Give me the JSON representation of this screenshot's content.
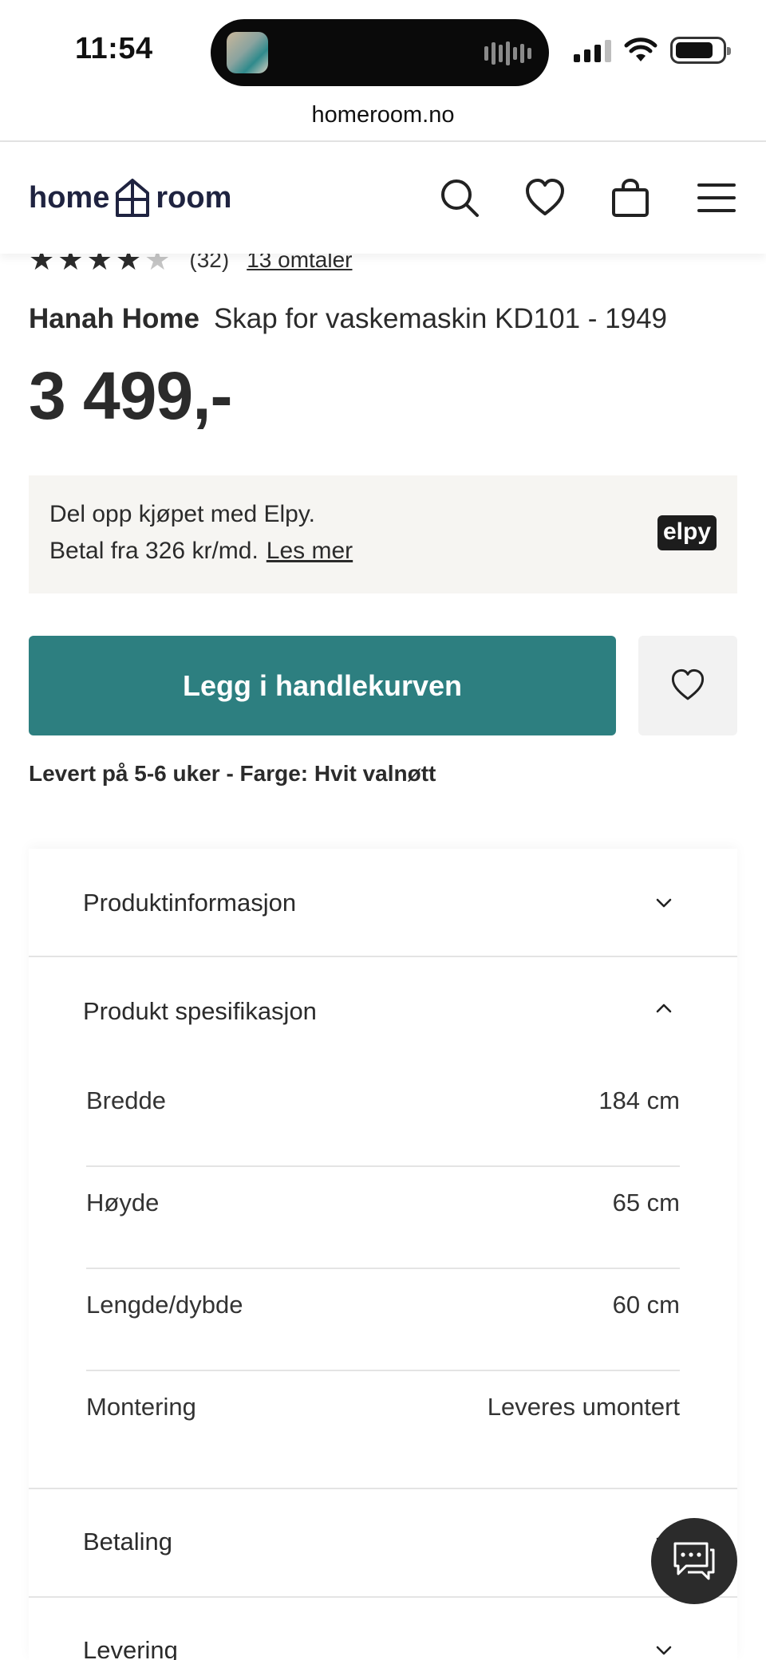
{
  "status_bar": {
    "time": "11:54"
  },
  "browser": {
    "url": "homeroom.no"
  },
  "header": {
    "logo_left": "home",
    "logo_right": "room",
    "icons": [
      "search-icon",
      "heart-icon",
      "bag-icon",
      "menu-icon"
    ]
  },
  "product": {
    "rating": 4,
    "rating_max": 5,
    "rating_count": "(32)",
    "reviews_link": "13 omtaler",
    "brand": "Hanah Home",
    "name": "Skap for vaskemaskin KD101 - 1949",
    "price": "3 499,-"
  },
  "financing": {
    "line1": "Del opp kjøpet med Elpy.",
    "line2": "Betal fra 326 kr/md.",
    "link": "Les mer",
    "logo": "elpy"
  },
  "cta": {
    "add_to_cart": "Legg i handlekurven",
    "delivery_note": "Levert på 5-6 uker - Farge: Hvit valnøtt"
  },
  "accordion": {
    "product_info": "Produktinformasjon",
    "specs_title": "Produkt spesifikasjon",
    "specs": [
      {
        "label": "Bredde",
        "value": "184 cm"
      },
      {
        "label": "Høyde",
        "value": "65 cm"
      },
      {
        "label": "Lengde/dybde",
        "value": "60 cm"
      },
      {
        "label": "Montering",
        "value": "Leveres umontert"
      }
    ],
    "payment": "Betaling",
    "delivery": "Levering"
  },
  "colors": {
    "accent": "#2d7f80",
    "panel": "#f6f5f2",
    "text": "#2b2b2b"
  }
}
